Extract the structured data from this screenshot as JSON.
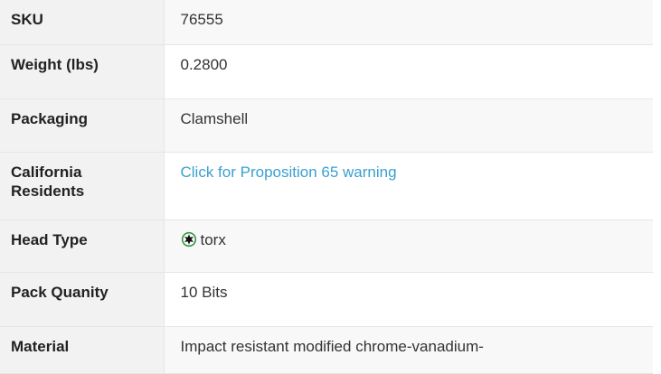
{
  "specs": {
    "rows": [
      {
        "label": "SKU",
        "value": "76555"
      },
      {
        "label": "Weight (lbs)",
        "value": "0.2800"
      },
      {
        "label": "Packaging",
        "value": "Clamshell"
      },
      {
        "label": "California Residents",
        "value": "Click for Proposition 65 warning"
      },
      {
        "label": "Head Type",
        "value": "torx",
        "icon": "torx-star-icon",
        "icon_color": "#2e9a3e"
      },
      {
        "label": "Pack Quanity",
        "value": "10 Bits"
      },
      {
        "label": "Material",
        "value": "Impact resistant modified chrome-vanadium-"
      }
    ]
  },
  "colors": {
    "link": "#3aa0cf",
    "label_background": "#f2f2f2",
    "border": "#e6e6e6",
    "text": "#333333"
  }
}
